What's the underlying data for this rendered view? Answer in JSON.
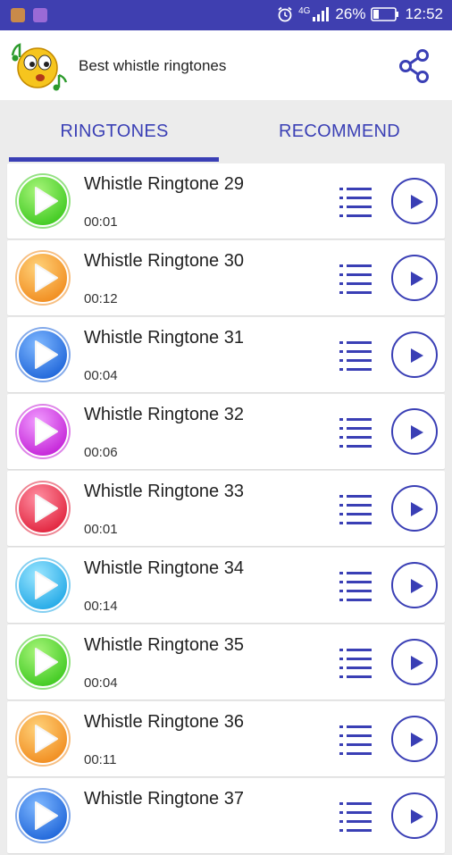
{
  "status_bar": {
    "network": "4G",
    "battery": "26%",
    "battery_level": 0.26,
    "time": "12:52",
    "left_icons": [
      "notification-app-icon",
      "gallery-app-icon"
    ],
    "right_icons": [
      "alarm-icon",
      "signal-icon",
      "battery-icon"
    ]
  },
  "app_bar": {
    "title": "Best whistle ringtones",
    "logo_icon": "whistling-emoji-icon",
    "share_icon": "share-icon"
  },
  "tabs": [
    {
      "label": "RINGTONES",
      "selected": true
    },
    {
      "label": "RECOMMEND",
      "selected": false
    }
  ],
  "colors": {
    "status_bar": "#3f3fb0",
    "accent": "#3a3fb5",
    "background": "#ececec",
    "card": "#ffffff"
  },
  "ringtones": [
    {
      "title": "Whistle Ringtone 29",
      "duration": "00:01",
      "orb_color": "#3cc81e",
      "orb_light": "#a8f57a"
    },
    {
      "title": "Whistle Ringtone 30",
      "duration": "00:12",
      "orb_color": "#f08a1c",
      "orb_light": "#ffd27a"
    },
    {
      "title": "Whistle Ringtone 31",
      "duration": "00:04",
      "orb_color": "#1c63d8",
      "orb_light": "#7fb8ff"
    },
    {
      "title": "Whistle Ringtone 32",
      "duration": "00:06",
      "orb_color": "#c21fd6",
      "orb_light": "#f19cff"
    },
    {
      "title": "Whistle Ringtone 33",
      "duration": "00:01",
      "orb_color": "#e0203a",
      "orb_light": "#ff8fa2"
    },
    {
      "title": "Whistle Ringtone 34",
      "duration": "00:14",
      "orb_color": "#1fa7e6",
      "orb_light": "#9be6ff"
    },
    {
      "title": "Whistle Ringtone 35",
      "duration": "00:04",
      "orb_color": "#3cc81e",
      "orb_light": "#a8f57a"
    },
    {
      "title": "Whistle Ringtone 36",
      "duration": "00:11",
      "orb_color": "#f08a1c",
      "orb_light": "#ffd27a"
    },
    {
      "title": "Whistle Ringtone 37",
      "duration": "",
      "orb_color": "#1c63d8",
      "orb_light": "#7fb8ff"
    }
  ]
}
